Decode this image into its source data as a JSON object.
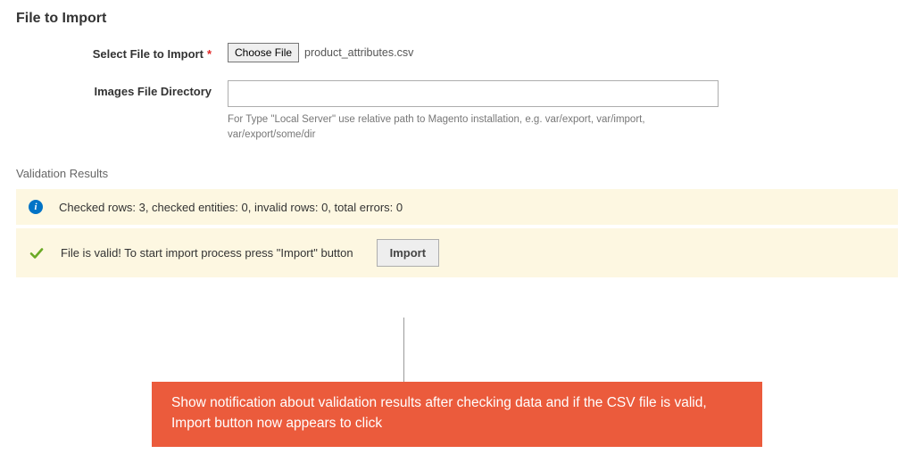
{
  "section": {
    "title": "File to Import"
  },
  "form": {
    "select_file_label": "Select File to Import",
    "choose_file_btn": "Choose File",
    "file_name": "product_attributes.csv",
    "images_dir_label": "Images File Directory",
    "images_dir_value": "",
    "images_dir_help": "For Type \"Local Server\" use relative path to Magento installation, e.g. var/export, var/import, var/export/some/dir"
  },
  "validation": {
    "title": "Validation Results",
    "info_text": "Checked rows: 3, checked entities: 0, invalid rows: 0, total errors: 0",
    "success_text": "File is valid! To start import process press \"Import\" button",
    "import_btn": "Import"
  },
  "annotation": {
    "text": "Show notification about validation results after checking data and if the CSV file is valid, Import button now appears to click"
  }
}
